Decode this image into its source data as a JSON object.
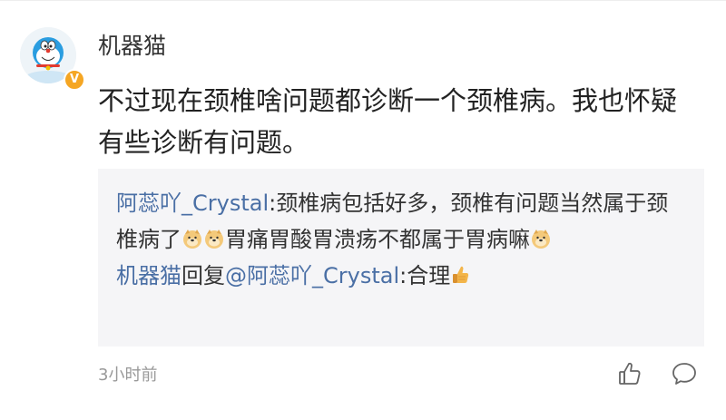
{
  "comment": {
    "username": "机器猫",
    "text": "不过现在颈椎啥问题都诊断一个颈椎病。我也怀疑有些诊断有问题。",
    "verified_badge": "V",
    "timestamp": "3小时前"
  },
  "replies": [
    {
      "author": "阿蕊吖_Crystal",
      "colon": ":",
      "text_part1": "颈椎病包括好多，颈椎有问题当然属于颈椎病了",
      "text_part2": "胃痛胃酸胃溃疡不都属于胃病嘛"
    },
    {
      "author": "机器猫",
      "reply_word": "回复",
      "mention": "@阿蕊吖_Crystal",
      "colon": ":",
      "text": "合理"
    }
  ],
  "icons": {
    "avatar": "doraemon-avatar",
    "badge": "verified-v-icon",
    "like": "thumbs-up-icon",
    "comment": "speech-bubble-icon",
    "emoji_doge": "doge-emoji",
    "emoji_thumbs": "thumbs-up-emoji"
  },
  "colors": {
    "link": "#4a6fa5",
    "reply_background": "#f5f5f7",
    "badge": "#f5a623",
    "muted": "#999999"
  }
}
